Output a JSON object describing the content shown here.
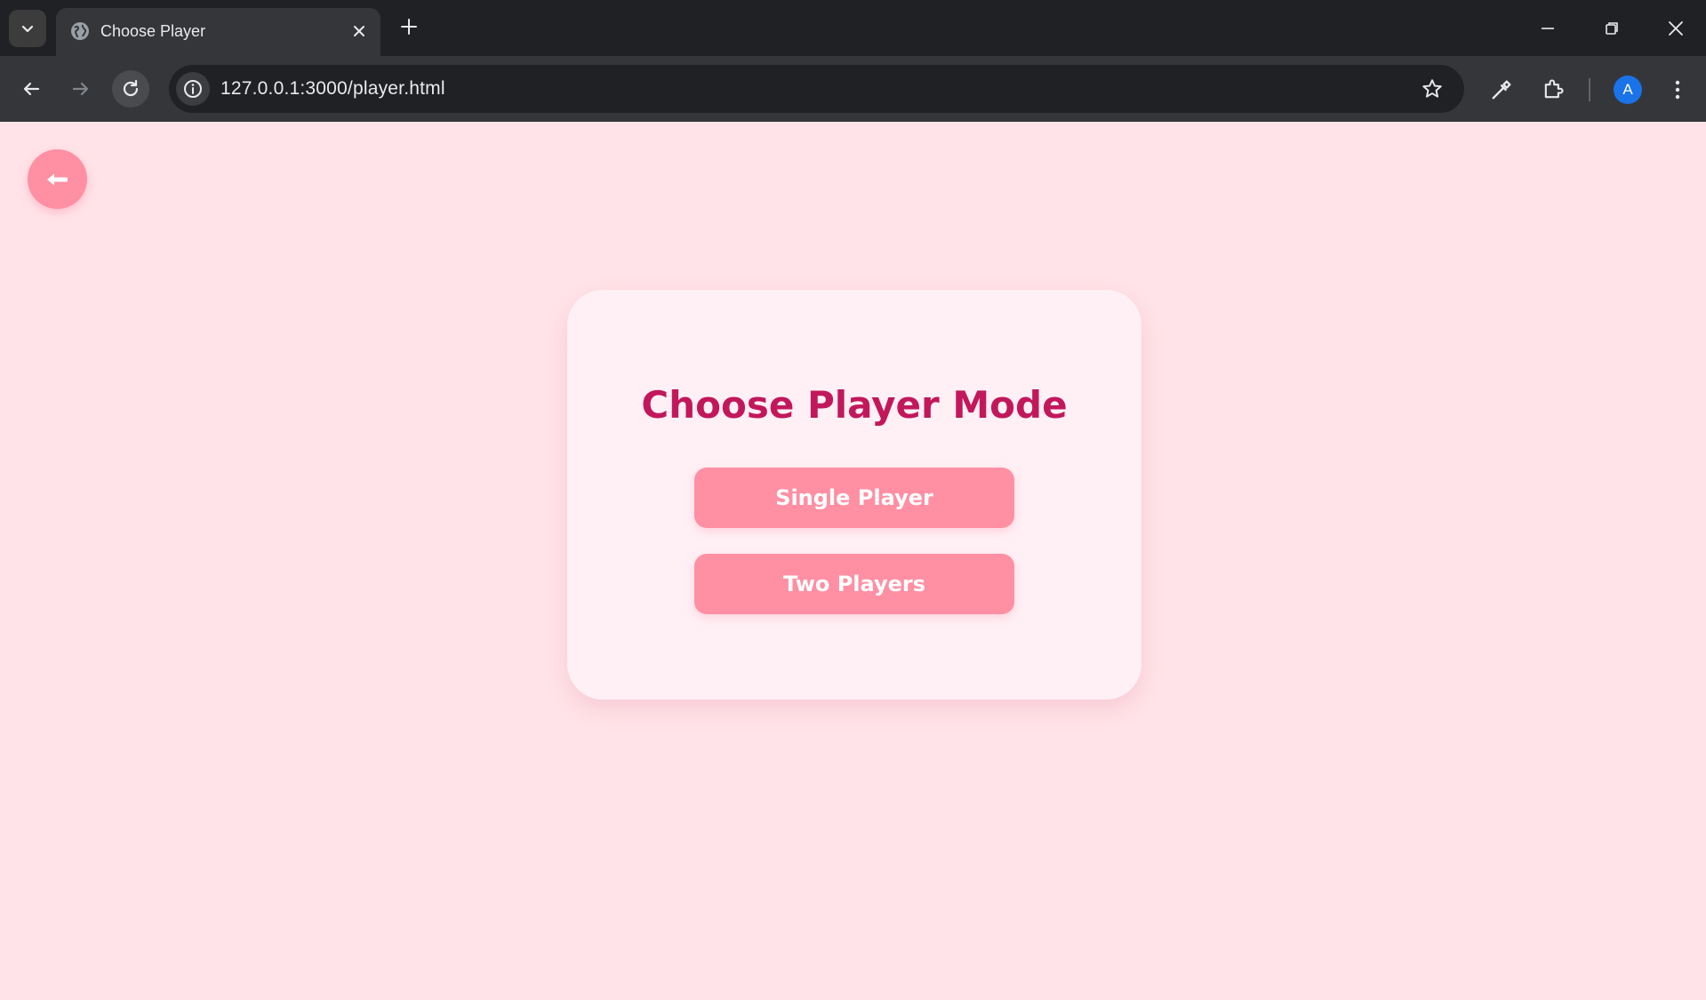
{
  "browser": {
    "tab": {
      "title": "Choose Player"
    },
    "address_bar": {
      "url": "127.0.0.1:3000/player.html"
    },
    "profile": {
      "initial": "A"
    }
  },
  "page": {
    "title": "Choose Player Mode",
    "buttons": {
      "single_label": "Single Player",
      "two_label": "Two Players"
    },
    "back_icon": "arrow-left-icon"
  },
  "colors": {
    "page_background": "#ffe3e8",
    "card_background": "#fff0f5",
    "accent_pink": "#ff8fa3",
    "title_color": "#c2185b",
    "browser_dark": "#202124",
    "browser_toolbar": "#35363a"
  }
}
